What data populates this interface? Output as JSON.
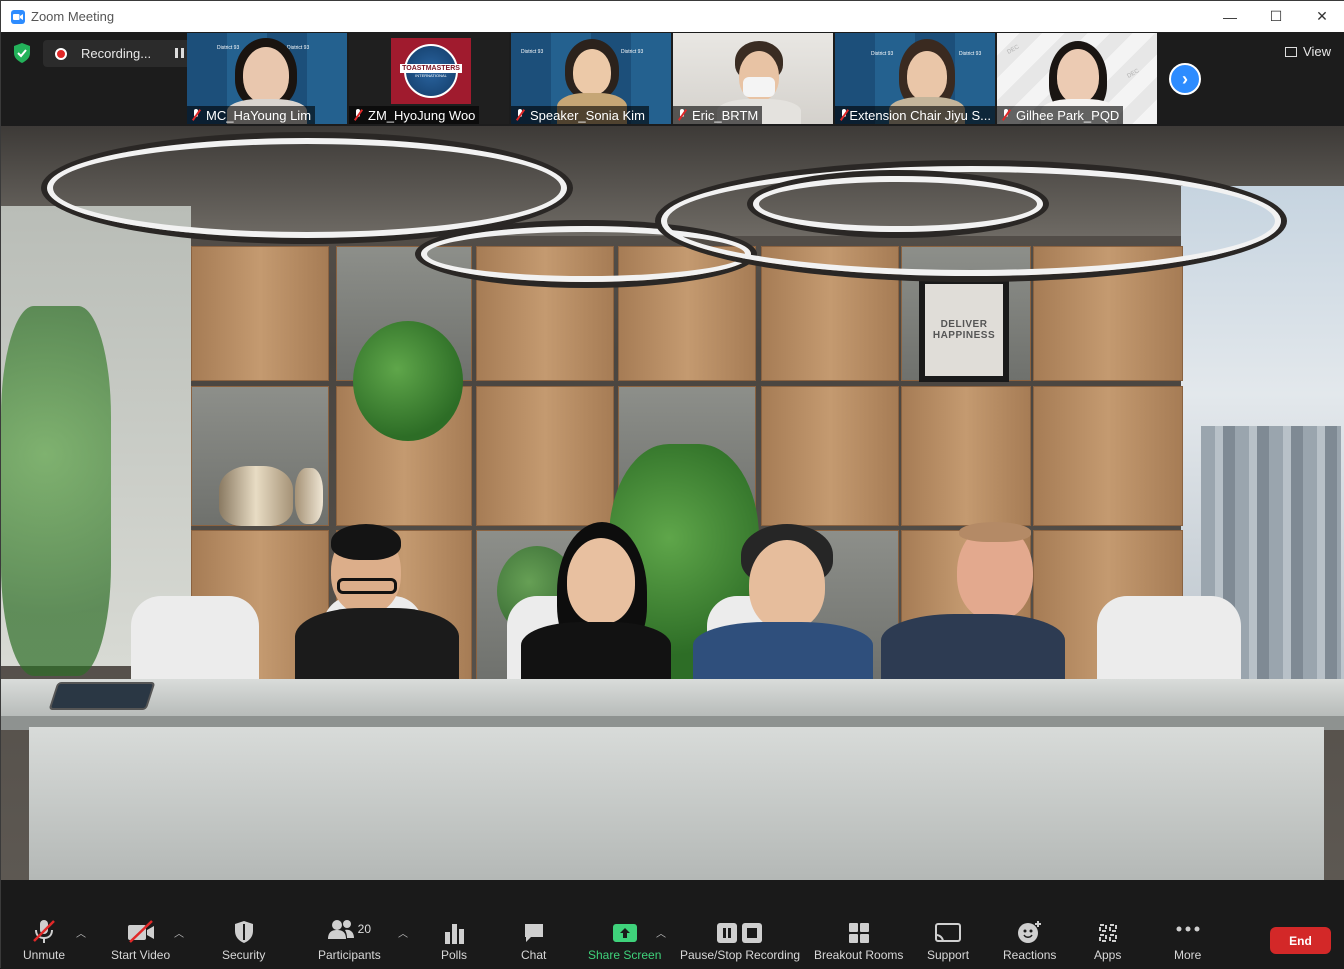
{
  "window": {
    "title": "Zoom Meeting",
    "minimize": "—",
    "maximize": "☐",
    "close": "✕"
  },
  "recording": {
    "label": "Recording..."
  },
  "thumbnails": [
    {
      "name": "MC_HaYoung Lim",
      "muted": true
    },
    {
      "name": "ZM_HyoJung Woo",
      "muted": true
    },
    {
      "name": "Speaker_Sonia Kim",
      "muted": true
    },
    {
      "name": "Eric_BRTM",
      "muted": true
    },
    {
      "name": "Extension Chair Jiyu S...",
      "muted": true
    },
    {
      "name": "Gilhee Park_PQD",
      "muted": true
    }
  ],
  "thumb_text": {
    "district": "District 93",
    "toastmasters_line1": "TOASTMASTERS",
    "toastmasters_line2": "INTERNATIONAL",
    "dec": "DEC"
  },
  "view_button": {
    "label": "View"
  },
  "main_video": {
    "poster_line1": "DELIVER",
    "poster_line2": "HAPPINESS"
  },
  "toolbar": {
    "unmute": "Unmute",
    "start_video": "Start Video",
    "security": "Security",
    "participants": "Participants",
    "participants_count": "20",
    "polls": "Polls",
    "chat": "Chat",
    "share_screen": "Share Screen",
    "pause_stop": "Pause/Stop Recording",
    "breakout": "Breakout Rooms",
    "support": "Support",
    "reactions": "Reactions",
    "apps": "Apps",
    "more": "More",
    "end": "End"
  },
  "colors": {
    "accent": "#2d8cff",
    "end_red": "#d32828",
    "share_green": "#3fd27b",
    "recording_red": "#e02828"
  }
}
